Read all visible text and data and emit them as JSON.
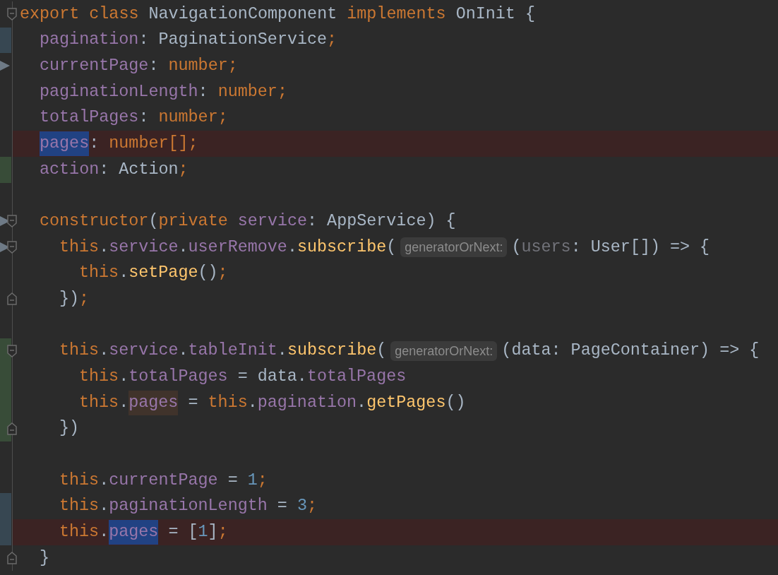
{
  "editor": {
    "lines": [
      {
        "error": false,
        "fold_open": true,
        "fold_close": false,
        "marker": false,
        "tokens": [
          {
            "text": "export",
            "kind": "keyword"
          },
          {
            "text": " class",
            "kind": "keyword"
          },
          {
            "text": " NavigationComponent",
            "kind": "plain"
          },
          {
            "text": " implements",
            "kind": "keyword"
          },
          {
            "text": " OnInit {",
            "kind": "plain"
          }
        ],
        "children": [
          {
            "color": "#374752",
            "error": false,
            "fold_open": false,
            "fold_close": false,
            "marker": false,
            "tokens": [
              {
                "text": "pagination",
                "kind": "field"
              },
              {
                "text": ": PaginationService",
                "kind": "plain"
              },
              {
                "text": ";",
                "kind": "keyword"
              }
            ]
          },
          {
            "error": false,
            "fold_open": false,
            "fold_close": false,
            "marker": true,
            "tokens": [
              {
                "text": "currentPage",
                "kind": "field"
              },
              {
                "text": ": ",
                "kind": "plain"
              },
              {
                "text": "number;",
                "kind": "keyword"
              }
            ]
          },
          {
            "error": false,
            "fold_open": false,
            "fold_close": false,
            "marker": false,
            "tokens": [
              {
                "text": "paginationLength",
                "kind": "field"
              },
              {
                "text": ": ",
                "kind": "plain"
              },
              {
                "text": "number;",
                "kind": "keyword"
              }
            ]
          },
          {
            "error": false,
            "fold_open": false,
            "fold_close": false,
            "marker": false,
            "tokens": [
              {
                "text": "totalPages",
                "kind": "field"
              },
              {
                "text": ": ",
                "kind": "plain"
              },
              {
                "text": "number;",
                "kind": "keyword"
              }
            ]
          },
          {
            "error": true,
            "fold_open": false,
            "fold_close": false,
            "marker": false,
            "tokens": [
              {
                "text": "pages",
                "kind": "field",
                "color": "#214283"
              },
              {
                "text": ": ",
                "kind": "plain"
              },
              {
                "text": "number[];",
                "kind": "keyword"
              }
            ]
          },
          {
            "color": "#384c38",
            "error": false,
            "fold_open": false,
            "fold_close": false,
            "marker": false,
            "tokens": [
              {
                "text": "action",
                "kind": "field"
              },
              {
                "text": ": Action",
                "kind": "plain"
              },
              {
                "text": ";",
                "kind": "keyword"
              }
            ]
          },
          {
            "error": false,
            "fold_open": false,
            "fold_close": false,
            "marker": false
          },
          {
            "error": false,
            "fold_open": true,
            "fold_close": false,
            "marker": true,
            "tokens": [
              {
                "text": "constructor",
                "kind": "keyword"
              },
              {
                "text": "(",
                "kind": "plain"
              },
              {
                "text": "private",
                "kind": "keyword"
              },
              {
                "text": " service",
                "kind": "field"
              },
              {
                "text": ": AppService) {",
                "kind": "plain"
              }
            ],
            "children": [
              {
                "error": false,
                "fold_open": true,
                "fold_close": false,
                "marker": true,
                "tokens": [
                  {
                    "text": "this",
                    "kind": "keyword"
                  },
                  {
                    "text": ".",
                    "kind": "plain"
                  },
                  {
                    "text": "service",
                    "kind": "field"
                  },
                  {
                    "text": ".",
                    "kind": "plain"
                  },
                  {
                    "text": "userRemove",
                    "kind": "field"
                  },
                  {
                    "text": ".",
                    "kind": "plain"
                  },
                  {
                    "text": "subscribe",
                    "kind": "method"
                  },
                  {
                    "text": "(",
                    "kind": "plain"
                  },
                  {
                    "text": "generatorOrNext:",
                    "kind": "hint"
                  },
                  {
                    "text": "(",
                    "kind": "plain"
                  },
                  {
                    "text": "users",
                    "kind": "unused"
                  },
                  {
                    "text": ": User[]) => {",
                    "kind": "plain"
                  }
                ],
                "children": [
                  {
                    "error": false,
                    "fold_open": false,
                    "fold_close": false,
                    "marker": false,
                    "tokens": [
                      {
                        "text": "this",
                        "kind": "keyword"
                      },
                      {
                        "text": ".",
                        "kind": "plain"
                      },
                      {
                        "text": "setPage",
                        "kind": "method"
                      },
                      {
                        "text": "()",
                        "kind": "plain"
                      },
                      {
                        "text": ";",
                        "kind": "keyword"
                      }
                    ]
                  }
                ]
              },
              {
                "error": false,
                "fold_open": false,
                "fold_close": true,
                "marker": false,
                "tokens": [
                  {
                    "text": "})",
                    "kind": "plain"
                  },
                  {
                    "text": ";",
                    "kind": "keyword"
                  }
                ]
              },
              {
                "error": false,
                "fold_open": false,
                "fold_close": false,
                "marker": false
              },
              {
                "color": "#384c38",
                "error": false,
                "fold_open": true,
                "fold_close": false,
                "marker": false,
                "tokens": [
                  {
                    "text": "this",
                    "kind": "keyword"
                  },
                  {
                    "text": ".",
                    "kind": "plain"
                  },
                  {
                    "text": "service",
                    "kind": "field"
                  },
                  {
                    "text": ".",
                    "kind": "plain"
                  },
                  {
                    "text": "tableInit",
                    "kind": "field"
                  },
                  {
                    "text": ".",
                    "kind": "plain"
                  },
                  {
                    "text": "subscribe",
                    "kind": "method"
                  },
                  {
                    "text": "(",
                    "kind": "plain"
                  },
                  {
                    "text": "generatorOrNext:",
                    "kind": "hint"
                  },
                  {
                    "text": "(data: PageContainer) => {",
                    "kind": "plain"
                  }
                ],
                "children": [
                  {
                    "color": "#384c38",
                    "error": false,
                    "fold_open": false,
                    "fold_close": false,
                    "marker": false,
                    "tokens": [
                      {
                        "text": "this",
                        "kind": "keyword"
                      },
                      {
                        "text": ".",
                        "kind": "plain"
                      },
                      {
                        "text": "totalPages",
                        "kind": "field"
                      },
                      {
                        "text": " = data.",
                        "kind": "plain"
                      },
                      {
                        "text": "totalPages",
                        "kind": "field"
                      }
                    ]
                  },
                  {
                    "color": "#384c38",
                    "error": false,
                    "fold_open": false,
                    "fold_close": false,
                    "marker": false,
                    "tokens": [
                      {
                        "text": "this",
                        "kind": "keyword"
                      },
                      {
                        "text": ".",
                        "kind": "plain"
                      },
                      {
                        "text": "pages",
                        "kind": "field",
                        "color": "#40332b"
                      },
                      {
                        "text": " = ",
                        "kind": "plain"
                      },
                      {
                        "text": "this",
                        "kind": "keyword"
                      },
                      {
                        "text": ".",
                        "kind": "plain"
                      },
                      {
                        "text": "pagination",
                        "kind": "field"
                      },
                      {
                        "text": ".",
                        "kind": "plain"
                      },
                      {
                        "text": "getPages",
                        "kind": "method"
                      },
                      {
                        "text": "()",
                        "kind": "plain"
                      }
                    ]
                  }
                ]
              },
              {
                "color": "#384c38",
                "error": false,
                "fold_open": false,
                "fold_close": true,
                "marker": false,
                "tokens": [
                  {
                    "text": "})",
                    "kind": "plain"
                  }
                ]
              },
              {
                "error": false,
                "fold_open": false,
                "fold_close": false,
                "marker": false
              },
              {
                "error": false,
                "fold_open": false,
                "fold_close": false,
                "marker": false,
                "tokens": [
                  {
                    "text": "this",
                    "kind": "keyword"
                  },
                  {
                    "text": ".",
                    "kind": "plain"
                  },
                  {
                    "text": "currentPage",
                    "kind": "field"
                  },
                  {
                    "text": " = ",
                    "kind": "plain"
                  },
                  {
                    "text": "1",
                    "kind": "number"
                  },
                  {
                    "text": ";",
                    "kind": "keyword"
                  }
                ]
              },
              {
                "color": "#374752",
                "error": false,
                "fold_open": false,
                "fold_close": false,
                "marker": false,
                "tokens": [
                  {
                    "text": "this",
                    "kind": "keyword"
                  },
                  {
                    "text": ".",
                    "kind": "plain"
                  },
                  {
                    "text": "paginationLength",
                    "kind": "field"
                  },
                  {
                    "text": " = ",
                    "kind": "plain"
                  },
                  {
                    "text": "3",
                    "kind": "number"
                  },
                  {
                    "text": ";",
                    "kind": "keyword"
                  }
                ]
              },
              {
                "color": "#374752",
                "error": true,
                "fold_open": false,
                "fold_close": false,
                "marker": false,
                "tokens": [
                  {
                    "text": "this",
                    "kind": "keyword"
                  },
                  {
                    "text": ".",
                    "kind": "plain"
                  },
                  {
                    "text": "pages",
                    "kind": "field",
                    "color": "#214283"
                  },
                  {
                    "text": " = [",
                    "kind": "plain"
                  },
                  {
                    "text": "1",
                    "kind": "number"
                  },
                  {
                    "text": "]",
                    "kind": "plain"
                  },
                  {
                    "text": ";",
                    "kind": "keyword"
                  }
                ]
              }
            ]
          },
          {
            "error": false,
            "fold_open": false,
            "fold_close": true,
            "marker": false,
            "tokens": [
              {
                "text": "}",
                "kind": "plain"
              }
            ]
          }
        ]
      }
    ]
  }
}
